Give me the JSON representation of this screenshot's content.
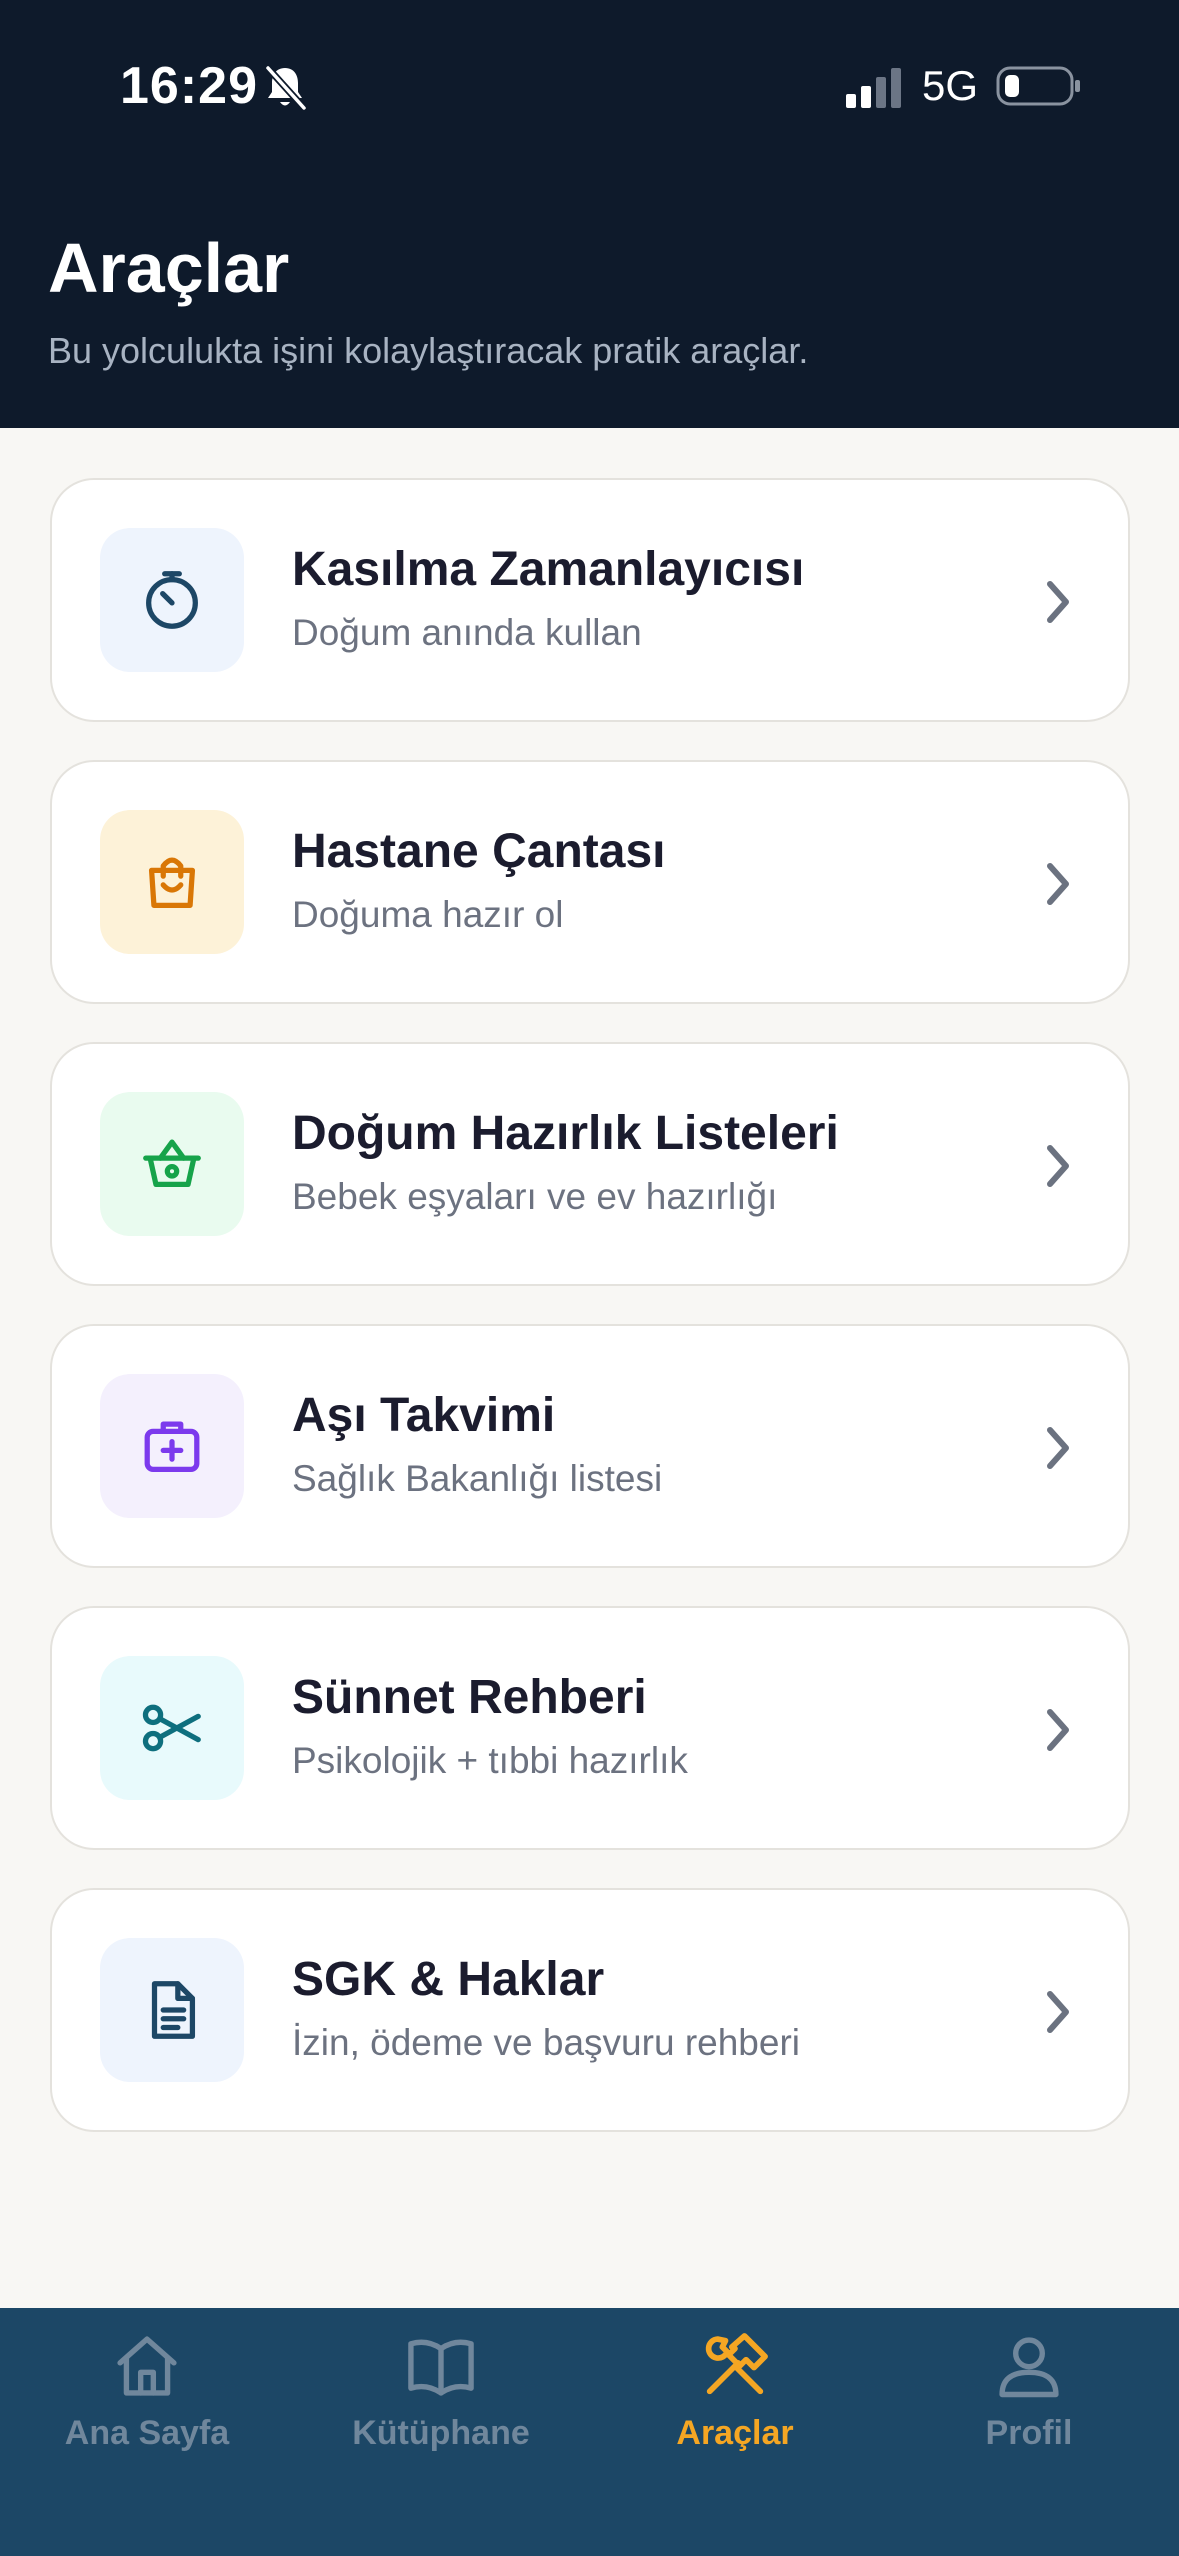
{
  "status_bar": {
    "time": "16:29",
    "network": "5G"
  },
  "header": {
    "title": "Araçlar",
    "subtitle": "Bu yolculukta işini kolaylaştıracak pratik araçlar."
  },
  "tools": [
    {
      "title": "Kasılma Zamanlayıcısı",
      "subtitle": "Doğum anında kullan",
      "icon": "timer-icon",
      "color": "#1d4766",
      "bg": "#eef4fd"
    },
    {
      "title": "Hastane Çantası",
      "subtitle": "Doğuma hazır ol",
      "icon": "shopping-bag-icon",
      "color": "#d97706",
      "bg": "#fdf2d8"
    },
    {
      "title": "Doğum Hazırlık Listeleri",
      "subtitle": "Bebek eşyaları ve ev hazırlığı",
      "icon": "basket-icon",
      "color": "#16a34a",
      "bg": "#e9fbef"
    },
    {
      "title": "Aşı Takvimi",
      "subtitle": "Sağlık Bakanlığı listesi",
      "icon": "medical-kit-icon",
      "color": "#7c3aed",
      "bg": "#f4f0fd"
    },
    {
      "title": "Sünnet Rehberi",
      "subtitle": "Psikolojik + tıbbi hazırlık",
      "icon": "scissors-icon",
      "color": "#0e6f7e",
      "bg": "#e8fafc"
    },
    {
      "title": "SGK & Haklar",
      "subtitle": "İzin, ödeme ve başvuru rehberi",
      "icon": "document-icon",
      "color": "#1d4766",
      "bg": "#eef4fd"
    }
  ],
  "tabbar": {
    "active_color": "#f5a623",
    "inactive_color": "#70879c",
    "tabs": [
      {
        "label": "Ana Sayfa",
        "icon": "home-icon",
        "active": false
      },
      {
        "label": "Kütüphane",
        "icon": "book-icon",
        "active": false
      },
      {
        "label": "Araçlar",
        "icon": "tools-icon",
        "active": true
      },
      {
        "label": "Profil",
        "icon": "user-icon",
        "active": false
      }
    ]
  }
}
